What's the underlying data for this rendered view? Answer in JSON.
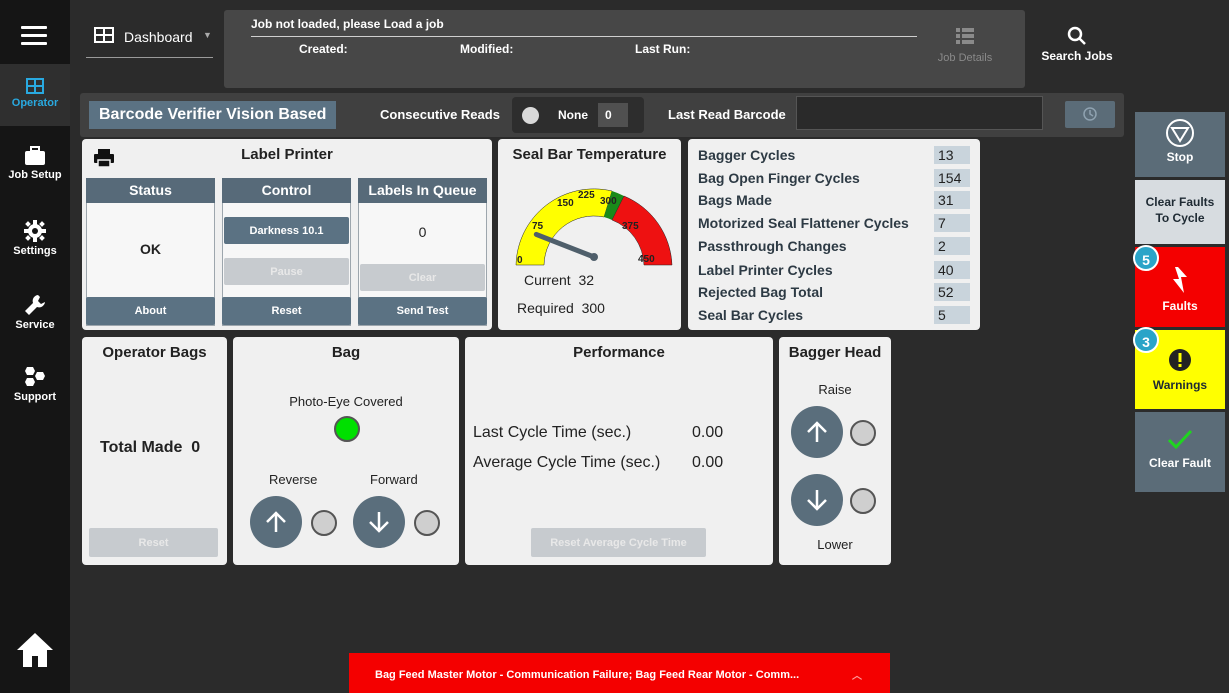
{
  "nav": {
    "items": [
      {
        "label": "Operator"
      },
      {
        "label": "Job Setup"
      },
      {
        "label": "Settings"
      },
      {
        "label": "Service"
      },
      {
        "label": "Support"
      }
    ]
  },
  "header": {
    "dashboard_label": "Dashboard",
    "job_title": "Job not loaded, please Load a job",
    "created_label": "Created:",
    "modified_label": "Modified:",
    "lastrun_label": "Last Run:",
    "job_details_label": "Job Details",
    "search_jobs_label": "Search Jobs"
  },
  "barcode": {
    "title": "Barcode Verifier Vision Based",
    "consecutive_label": "Consecutive Reads",
    "toggle_label": "None",
    "count": "0",
    "last_read_label": "Last Read Barcode",
    "last_read_value": ""
  },
  "label_printer": {
    "title": "Label Printer",
    "status_header": "Status",
    "status_value": "OK",
    "about_label": "About",
    "control_header": "Control",
    "darkness_label": "Darkness 10.1",
    "pause_label": "Pause",
    "reset_label": "Reset",
    "queue_header": "Labels In Queue",
    "queue_value": "0",
    "clear_label": "Clear",
    "send_test_label": "Send Test"
  },
  "seal_bar": {
    "title": "Seal Bar Temperature",
    "gauge_ticks": [
      "0",
      "75",
      "150",
      "225",
      "300",
      "375",
      "450"
    ],
    "current_label": "Current",
    "current_value": "32",
    "required_label": "Required",
    "required_value": "300",
    "gauge_level": 32,
    "gauge_max": 450
  },
  "stats": {
    "rows": [
      {
        "label": "Bagger Cycles",
        "value": "13"
      },
      {
        "label": "Bag Open Finger Cycles",
        "value": "154"
      },
      {
        "label": "Bags Made",
        "value": "31"
      },
      {
        "label": "Motorized Seal Flattener Cycles",
        "value": "7"
      },
      {
        "label": "Passthrough Changes",
        "value": "2"
      },
      {
        "label": "Label Printer Cycles",
        "value": "40"
      },
      {
        "label": "Rejected Bag Total",
        "value": "52"
      },
      {
        "label": "Seal Bar Cycles",
        "value": "5"
      }
    ]
  },
  "operator_bags": {
    "title": "Operator Bags",
    "total_label": "Total Made",
    "total_value": "0",
    "reset_label": "Reset"
  },
  "bag": {
    "title": "Bag",
    "photo_eye_label": "Photo-Eye Covered",
    "reverse_label": "Reverse",
    "forward_label": "Forward"
  },
  "performance": {
    "title": "Performance",
    "last_cycle_label": "Last Cycle Time (sec.)",
    "last_cycle_value": "0.00",
    "avg_cycle_label": "Average Cycle Time (sec.)",
    "avg_cycle_value": "0.00",
    "reset_label": "Reset Average Cycle Time"
  },
  "bagger_head": {
    "title": "Bagger Head",
    "raise_label": "Raise",
    "lower_label": "Lower"
  },
  "right_panel": {
    "stop_label": "Stop",
    "clear_faults_label_1": "Clear Faults",
    "clear_faults_label_2": "To Cycle",
    "faults_label": "Faults",
    "faults_count": "5",
    "warnings_label": "Warnings",
    "warnings_count": "3",
    "clear_fault_label": "Clear Fault"
  },
  "alert": {
    "message": "Bag Feed Master Motor - Communication Failure; Bag Feed Rear Motor - Comm..."
  },
  "colors": {
    "accent": "#29a9e0",
    "button": "#5b7283",
    "fault": "#f40000",
    "warning": "#ffff00",
    "led_on": "#00e000"
  }
}
